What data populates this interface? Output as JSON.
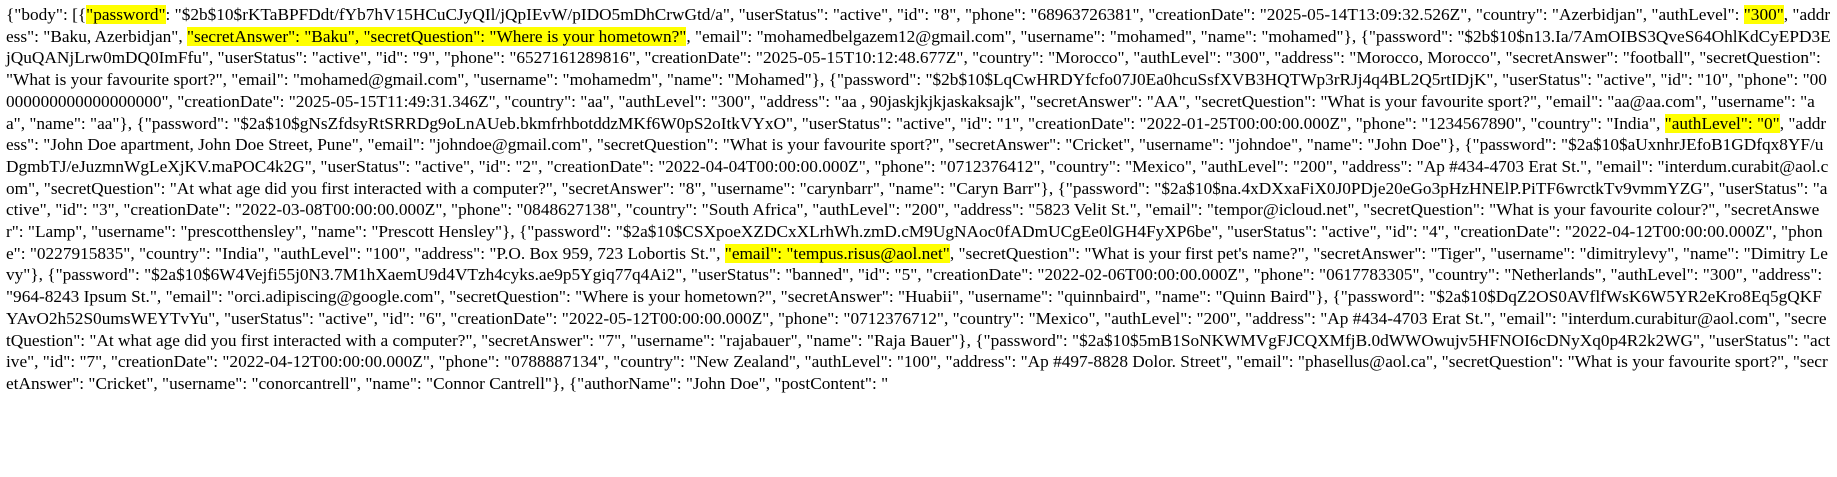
{
  "segments": [
    {
      "text": "{\"body\": [{",
      "highlight": false
    },
    {
      "text": "\"password\"",
      "highlight": true
    },
    {
      "text": ": \"$2b$10$rKTaBPFDdt/fYb7hV15HCuCJyQIl/jQpIEvW/pIDO5mDhCrwGtd/a\", \"userStatus\": \"active\", \"id\": \"8\", \"phone\": \"68963726381\", \"creationDate\": \"2025-05-14T13:09:32.526Z\", \"country\": \"Azerbidjan\", \"authLevel\": ",
      "highlight": false
    },
    {
      "text": "\"300\"",
      "highlight": true
    },
    {
      "text": ", \"address\": \"Baku, Azerbidjan\", ",
      "highlight": false
    },
    {
      "text": "\"secretAnswer\": \"Baku\", \"secretQuestion\": \"Where is your hometown?\"",
      "highlight": true
    },
    {
      "text": ", \"email\": \"mohamedbelgazem12@gmail.com\", \"username\": \"mohamed\", \"name\": \"mohamed\"}, {\"password\": \"$2b$10$n13.Ia/7AmOIBS3QveS64OhlKdCyEPD3EjQuQANjLrw0mDQ0ImFfu\", \"userStatus\": \"active\", \"id\": \"9\", \"phone\": \"6527161289816\", \"creationDate\": \"2025-05-15T10:12:48.677Z\", \"country\": \"Morocco\", \"authLevel\": \"300\", \"address\": \"Morocco, Morocco\", \"secretAnswer\": \"football\", \"secretQuestion\": \"What is your favourite sport?\", \"email\": \"mohamed@gmail.com\", \"username\": \"mohamedm\", \"name\": \"Mohamed\"}, {\"password\": \"$2b$10$LqCwHRDYfcfo07J0Ea0hcuSsfXVB3HQTWp3rRJj4q4BL2Q5rtIDjK\", \"userStatus\": \"active\", \"id\": \"10\", \"phone\": \"00000000000000000000\", \"creationDate\": \"2025-05-15T11:49:31.346Z\", \"country\": \"aa\", \"authLevel\": \"300\", \"address\": \"aa , 90jaskjkjkjaskaksajk\", \"secretAnswer\": \"AA\", \"secretQuestion\": \"What is your favourite sport?\", \"email\": \"aa@aa.com\", \"username\": \"aa\", \"name\": \"aa\"}, {\"password\": \"$2a$10$gNsZfdsyRtSRRDg9oLnAUeb.bkmfrhbotddzMKf6W0pS2oItkVYxO\", \"userStatus\": \"active\", \"id\": \"1\", \"creationDate\": \"2022-01-25T00:00:00.000Z\", \"phone\": \"1234567890\", \"country\": \"India\", ",
      "highlight": false
    },
    {
      "text": "\"authLevel\": \"0\"",
      "highlight": true
    },
    {
      "text": ", \"address\": \"John Doe apartment, John Doe Street, Pune\", \"email\": \"johndoe@gmail.com\", \"secretQuestion\": \"What is your favourite sport?\", \"secretAnswer\": \"Cricket\", \"username\": \"johndoe\", \"name\": \"John Doe\"}, {\"password\": \"$2a$10$aUxnhrJEfoB1GDfqx8YF/uDgmbTJ/eJuzmnWgLeXjKV.maPOC4k2G\", \"userStatus\": \"active\", \"id\": \"2\", \"creationDate\": \"2022-04-04T00:00:00.000Z\", \"phone\": \"0712376412\", \"country\": \"Mexico\", \"authLevel\": \"200\", \"address\": \"Ap #434-4703 Erat St.\", \"email\": \"interdum.curabit@aol.com\", \"secretQuestion\": \"At what age did you first interacted with a computer?\", \"secretAnswer\": \"8\", \"username\": \"carynbarr\", \"name\": \"Caryn Barr\"}, {\"password\": \"$2a$10$na.4xDXxaFiX0J0PDje20eGo3pHzHNElP.PiTF6wrctkTv9vmmYZG\", \"userStatus\": \"active\", \"id\": \"3\", \"creationDate\": \"2022-03-08T00:00:00.000Z\", \"phone\": \"0848627138\", \"country\": \"South Africa\", \"authLevel\": \"200\", \"address\": \"5823 Velit St.\", \"email\": \"tempor@icloud.net\", \"secretQuestion\": \"What is your favourite colour?\", \"secretAnswer\": \"Lamp\", \"username\": \"prescotthensley\", \"name\": \"Prescott Hensley\"}, {\"password\": \"$2a$10$CSXpoeXZDCxXLrhWh.zmD.cM9UgNAoc0fADmUCgEe0lGH4FyXP6be\", \"userStatus\": \"active\", \"id\": \"4\", \"creationDate\": \"2022-04-12T00:00:00.000Z\", \"phone\": \"0227915835\", \"country\": \"India\", \"authLevel\": \"100\", \"address\": \"P.O. Box 959, 723 Lobortis St.\", ",
      "highlight": false
    },
    {
      "text": "\"email\": \"tempus.risus@aol.net\"",
      "highlight": true
    },
    {
      "text": ", \"secretQuestion\": \"What is your first pet's name?\", \"secretAnswer\": \"Tiger\", \"username\": \"dimitrylevy\", \"name\": \"Dimitry Levy\"}, {\"password\": \"$2a$10$6W4Vejfi55j0N3.7M1hXaemU9d4VTzh4cyks.ae9p5Ygiq77q4Ai2\", \"userStatus\": \"banned\", \"id\": \"5\", \"creationDate\": \"2022-02-06T00:00:00.000Z\", \"phone\": \"0617783305\", \"country\": \"Netherlands\", \"authLevel\": \"300\", \"address\": \"964-8243 Ipsum St.\", \"email\": \"orci.adipiscing@google.com\", \"secretQuestion\": \"Where is your hometown?\", \"secretAnswer\": \"Huabii\", \"username\": \"quinnbaird\", \"name\": \"Quinn Baird\"}, {\"password\": \"$2a$10$DqZ2OS0AVflfWsK6W5YR2eKro8Eq5gQKFYAvO2h52S0umsWEYTvYu\", \"userStatus\": \"active\", \"id\": \"6\", \"creationDate\": \"2022-05-12T00:00:00.000Z\", \"phone\": \"0712376712\", \"country\": \"Mexico\", \"authLevel\": \"200\", \"address\": \"Ap #434-4703 Erat St.\", \"email\": \"interdum.curabitur@aol.com\", \"secretQuestion\": \"At what age did you first interacted with a computer?\", \"secretAnswer\": \"7\", \"username\": \"rajabauer\", \"name\": \"Raja Bauer\"}, {\"password\": \"$2a$10$5mB1SoNKWMVgFJCQXMfjB.0dWWOwujv5HFNOI6cDNyXq0p4R2k2WG\", \"userStatus\": \"active\", \"id\": \"7\", \"creationDate\": \"2022-04-12T00:00:00.000Z\", \"phone\": \"0788887134\", \"country\": \"New Zealand\", \"authLevel\": \"100\", \"address\": \"Ap #497-8828 Dolor. Street\", \"email\": \"phasellus@aol.ca\", \"secretQuestion\": \"What is your favourite sport?\", \"secretAnswer\": \"Cricket\", \"username\": \"conorcantrell\", \"name\": \"Connor Cantrell\"}, {\"authorName\": \"John Doe\", \"postContent\": \"",
      "highlight": false
    }
  ],
  "colors": {
    "text": "#000000",
    "background": "#ffffff",
    "highlight": "#ffff00"
  }
}
